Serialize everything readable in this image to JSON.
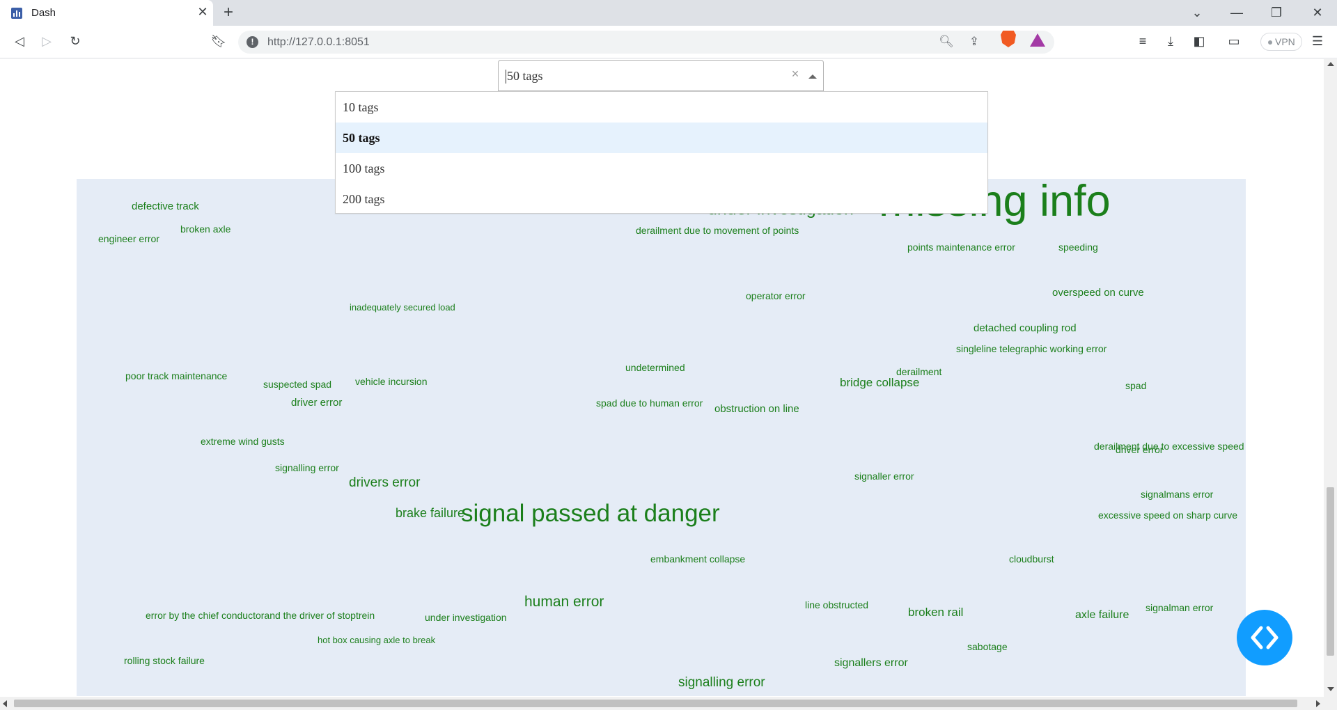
{
  "browser": {
    "tab_title": "Dash",
    "url": "http://127.0.0.1:8051",
    "vpn_label": "VPN"
  },
  "dropdown": {
    "selected": "50 tags",
    "options": [
      "10 tags",
      "50 tags",
      "100 tags",
      "200 tags"
    ]
  },
  "wordcloud": {
    "tags": [
      "missing info",
      "under investigation",
      "defective track",
      "broken axle",
      "engineer error",
      "derailment due to movement of points",
      "points maintenance error",
      "speeding",
      "inadequately secured load",
      "operator error",
      "overspeed on curve",
      "detached coupling rod",
      "singleline telegraphic working error",
      "poor track maintenance",
      "suspected spad",
      "vehicle incursion",
      "undetermined",
      "derailment",
      "bridge collapse",
      "spad",
      "driver error",
      "spad due to human error",
      "obstruction on line",
      "extreme wind gusts",
      "derailment due to excessive speed",
      "driver error",
      "signalling error",
      "signaller error",
      "drivers error",
      "signalmans error",
      "brake failure",
      "signal passed at danger",
      "excessive speed on sharp curve",
      "embankment collapse",
      "cloudburst",
      "human error",
      "line obstructed",
      "broken rail",
      "axle failure",
      "signalman error",
      "error by the chief conductorand the driver of stoptrein",
      "under investigation",
      "hot box causing axle to break",
      "sabotage",
      "rolling stock failure",
      "signallers error",
      "signalling error"
    ]
  }
}
